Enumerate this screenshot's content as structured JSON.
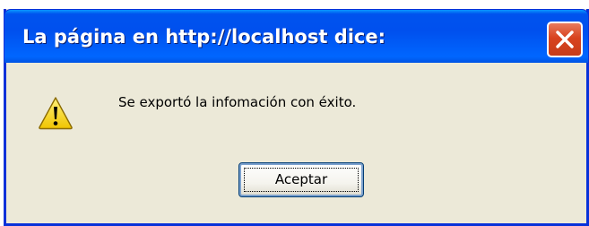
{
  "dialog": {
    "title": "La página en http://localhost dice:",
    "message": "Se exportó la infomación con éxito.",
    "ok_label": "Aceptar",
    "icon": "warning-icon",
    "close_icon": "close-icon"
  },
  "colors": {
    "titlebar": "#0054e3",
    "close_button": "#d8431f",
    "dialog_background": "#ece9d8",
    "warning_yellow": "#f8d81c"
  }
}
